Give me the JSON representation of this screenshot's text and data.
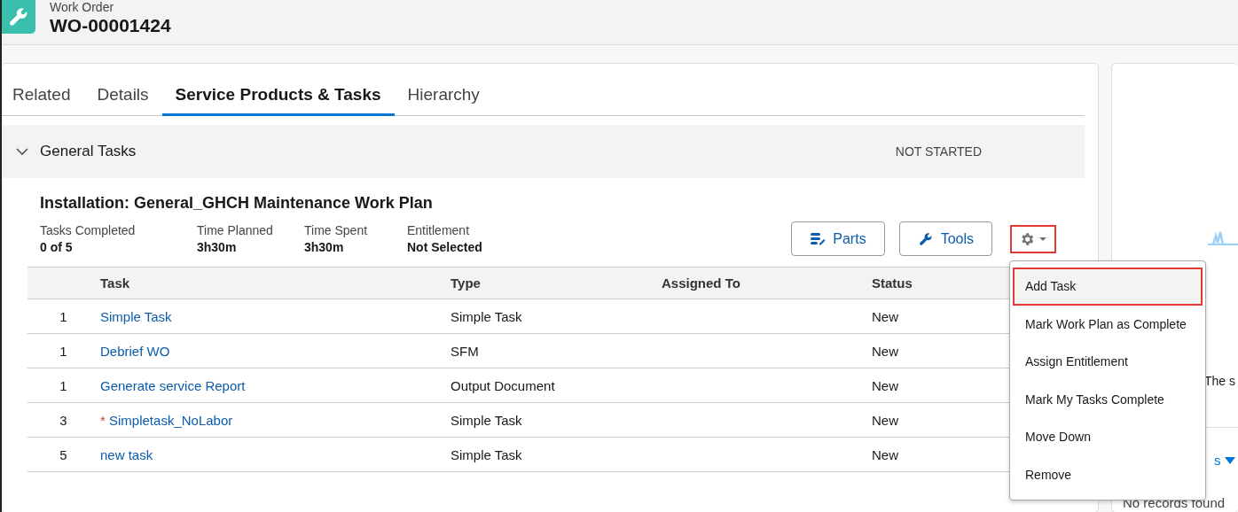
{
  "header": {
    "object_type": "Work Order",
    "record_name": "WO-00001424"
  },
  "tabs": [
    {
      "label": "Related",
      "selected": false
    },
    {
      "label": "Details",
      "selected": false
    },
    {
      "label": "Service Products & Tasks",
      "selected": true
    },
    {
      "label": "Hierarchy",
      "selected": false
    }
  ],
  "section": {
    "title": "General Tasks",
    "expanded": true,
    "status": "NOT STARTED"
  },
  "work_plan": {
    "title": "Installation: General_GHCH Maintenance Work Plan",
    "stats": [
      {
        "label": "Tasks Completed",
        "value": "0 of 5"
      },
      {
        "label": "Time Planned",
        "value": "3h30m"
      },
      {
        "label": "Time Spent",
        "value": "3h30m"
      },
      {
        "label": "Entitlement",
        "value": "Not Selected"
      }
    ],
    "buttons": [
      {
        "kind": "parts",
        "label": "Parts"
      },
      {
        "kind": "tools",
        "label": "Tools"
      }
    ],
    "settings_highlighted": true
  },
  "table": {
    "columns": [
      "Task",
      "Type",
      "Assigned To",
      "Status"
    ],
    "rows": [
      {
        "sequence": "1",
        "task": "Simple Task",
        "required": false,
        "type": "Simple Task",
        "status": "New"
      },
      {
        "sequence": "1",
        "task": "Debrief WO",
        "required": false,
        "type": "SFM",
        "status": "New"
      },
      {
        "sequence": "1",
        "task": "Generate service Report",
        "required": false,
        "type": "Output Document",
        "status": "New"
      },
      {
        "sequence": "3",
        "task": "Simpletask_NoLabor",
        "required": true,
        "required_mark": "*",
        "type": "Simple Task",
        "status": "New"
      },
      {
        "sequence": "5",
        "task": "new task",
        "required": false,
        "type": "Simple Task",
        "status": "New"
      }
    ]
  },
  "menu": [
    {
      "label": "Add Task",
      "selected": true
    },
    {
      "label": "Mark Work Plan as Complete",
      "selected": false
    },
    {
      "label": "Assign Entitlement",
      "selected": false
    },
    {
      "label": "Mark My Tasks Complete",
      "selected": false
    },
    {
      "label": "Move Down",
      "selected": false
    },
    {
      "label": "Remove",
      "selected": false
    }
  ],
  "side_panel": {
    "text": "The s",
    "link": "s",
    "empty_text": "No records found"
  }
}
